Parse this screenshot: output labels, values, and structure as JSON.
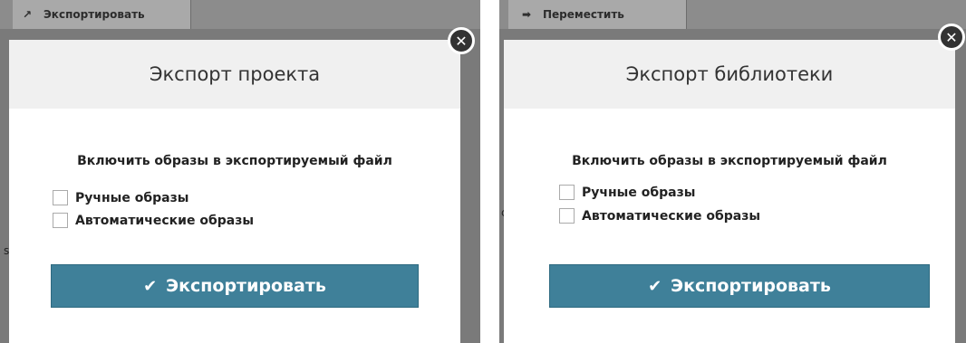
{
  "left": {
    "background_button": {
      "icon": "external-link-icon",
      "label": "Экспортировать"
    },
    "dialog": {
      "title": "Экспорт проекта",
      "close_icon": "close-icon",
      "section_title": "Включить образы в экспортируемый файл",
      "options": [
        {
          "label": "Ручные образы",
          "checked": false
        },
        {
          "label": "Автоматические образы",
          "checked": false
        }
      ],
      "export_button": {
        "icon": "checkmark-icon",
        "label": "Экспортировать"
      }
    }
  },
  "right": {
    "background_button": {
      "icon": "arrow-right-icon",
      "label": "Переместить"
    },
    "dialog": {
      "title": "Экспорт библиотеки",
      "close_icon": "close-icon",
      "section_title": "Включить образы в экспортируемый файл",
      "options": [
        {
          "label": "Ручные образы",
          "checked": false
        },
        {
          "label": "Автоматические образы",
          "checked": false
        }
      ],
      "export_button": {
        "icon": "checkmark-icon",
        "label": "Экспортировать"
      }
    }
  },
  "colors": {
    "overlay": "#7a7a7a",
    "header_bg": "#f0f0f0",
    "export_button": "#3f8099",
    "close_button": "#333333"
  }
}
